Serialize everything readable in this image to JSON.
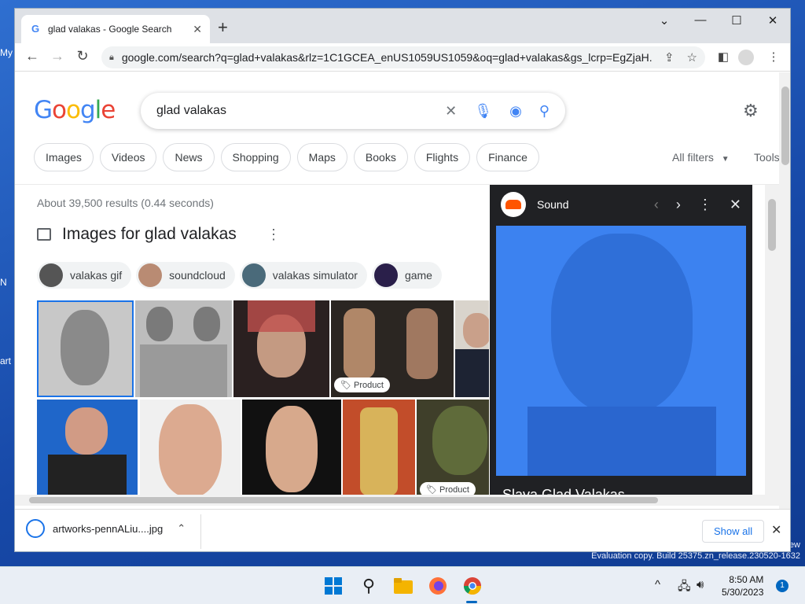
{
  "desktop": {
    "labels": [
      "My",
      "N",
      "art"
    ],
    "watermark_line1": "ew",
    "watermark_line2": "Evaluation copy. Build 25375.zn_release.230520-1632"
  },
  "browser": {
    "tab_title": "glad valakas - Google Search",
    "url": "google.com/search?q=glad+valakas&rlz=1C1GCEA_enUS1059US1059&oq=glad+valakas&gs_lcrp=EgZjaH..."
  },
  "google": {
    "logo": "Google",
    "query": "glad valakas",
    "chips": [
      "Images",
      "Videos",
      "News",
      "Shopping",
      "Maps",
      "Books",
      "Flights",
      "Finance"
    ],
    "all_filters": "All filters",
    "tools": "Tools",
    "result_stats": "About 39,500 results (0.44 seconds)",
    "images_header": "Images for glad valakas",
    "refinements": [
      "valakas gif",
      "soundcloud",
      "valakas simulator",
      "game"
    ],
    "badge_product": "Product"
  },
  "side_panel": {
    "title": "Sound",
    "caption": "Slava Glad Valakas"
  },
  "download": {
    "filename": "artworks-pennALiu....jpg",
    "show_all": "Show all"
  },
  "taskbar": {
    "time": "8:50 AM",
    "date": "5/30/2023",
    "notifications": "1"
  },
  "colors": {
    "accent": "#1a73e8",
    "soundcloud": "#ff5500",
    "panel_bg": "#202124"
  }
}
